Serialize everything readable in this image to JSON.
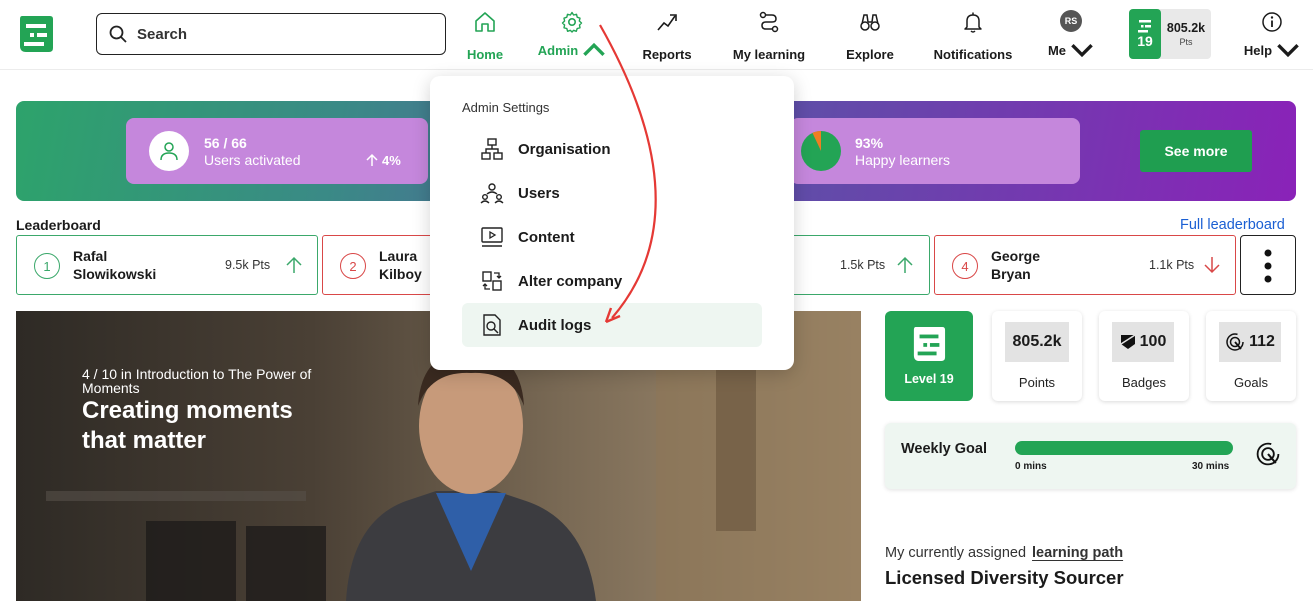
{
  "nav": {
    "search_placeholder": "Search",
    "items": [
      {
        "label": "Home",
        "icon": "home-icon"
      },
      {
        "label": "Admin",
        "icon": "gear-icon"
      },
      {
        "label": "Reports",
        "icon": "trend-icon"
      },
      {
        "label": "My learning",
        "icon": "path-icon"
      },
      {
        "label": "Explore",
        "icon": "binoculars-icon"
      },
      {
        "label": "Notifications",
        "icon": "bell-icon"
      },
      {
        "label": "Me",
        "icon": "avatar"
      },
      {
        "label": "Help",
        "icon": "info-icon"
      }
    ],
    "avatar_initials": "RS",
    "level": "19",
    "points": "805.2k",
    "points_unit": "Pts"
  },
  "banner": {
    "stat1_value": "56 / 66",
    "stat1_label": "Users activated",
    "stat1_change": "4%",
    "stat2_value": "93%",
    "stat2_label": "Happy learners",
    "stat2_fraction": 0.93,
    "see_more": "See more"
  },
  "leaderboard": {
    "title": "Leaderboard",
    "link": "Full leaderboard",
    "entries": [
      {
        "rank": "1",
        "name": "Rafal\nSlowikowski",
        "points": "9.5k Pts",
        "trend": "up"
      },
      {
        "rank": "2",
        "name": "Laura\nKilboy",
        "points": "",
        "trend": "down"
      },
      {
        "rank": "",
        "name": "",
        "points": "1.5k Pts",
        "trend": "up"
      },
      {
        "rank": "4",
        "name": "George\nBryan",
        "points": "1.1k Pts",
        "trend": "down"
      }
    ]
  },
  "video": {
    "subtitle": "4 / 10 in Introduction to The Power of Moments",
    "title": "Creating moments that matter"
  },
  "stats": {
    "level_label": "Level 19",
    "points_value": "805.2k",
    "points_label": "Points",
    "badges_value": "100",
    "badges_label": "Badges",
    "goals_value": "112",
    "goals_label": "Goals"
  },
  "weekly_goal": {
    "title": "Weekly Goal",
    "min": "0 mins",
    "max": "30 mins",
    "progress": 1.0
  },
  "assigned": {
    "prefix": "My currently assigned",
    "link": "learning path",
    "course": "Licensed Diversity Sourcer"
  },
  "admin_menu": {
    "heading": "Admin Settings",
    "items": [
      {
        "label": "Organisation",
        "icon": "organisation-icon"
      },
      {
        "label": "Users",
        "icon": "users-icon"
      },
      {
        "label": "Content",
        "icon": "content-icon"
      },
      {
        "label": "Alter company",
        "icon": "alter-company-icon"
      },
      {
        "label": "Audit logs",
        "icon": "audit-logs-icon"
      }
    ],
    "highlighted": "Audit logs"
  },
  "colors": {
    "brand_green": "#23a455",
    "annotation_red": "#e53935",
    "stat_card": "#c587dc",
    "link_blue": "#1a5fd3"
  }
}
